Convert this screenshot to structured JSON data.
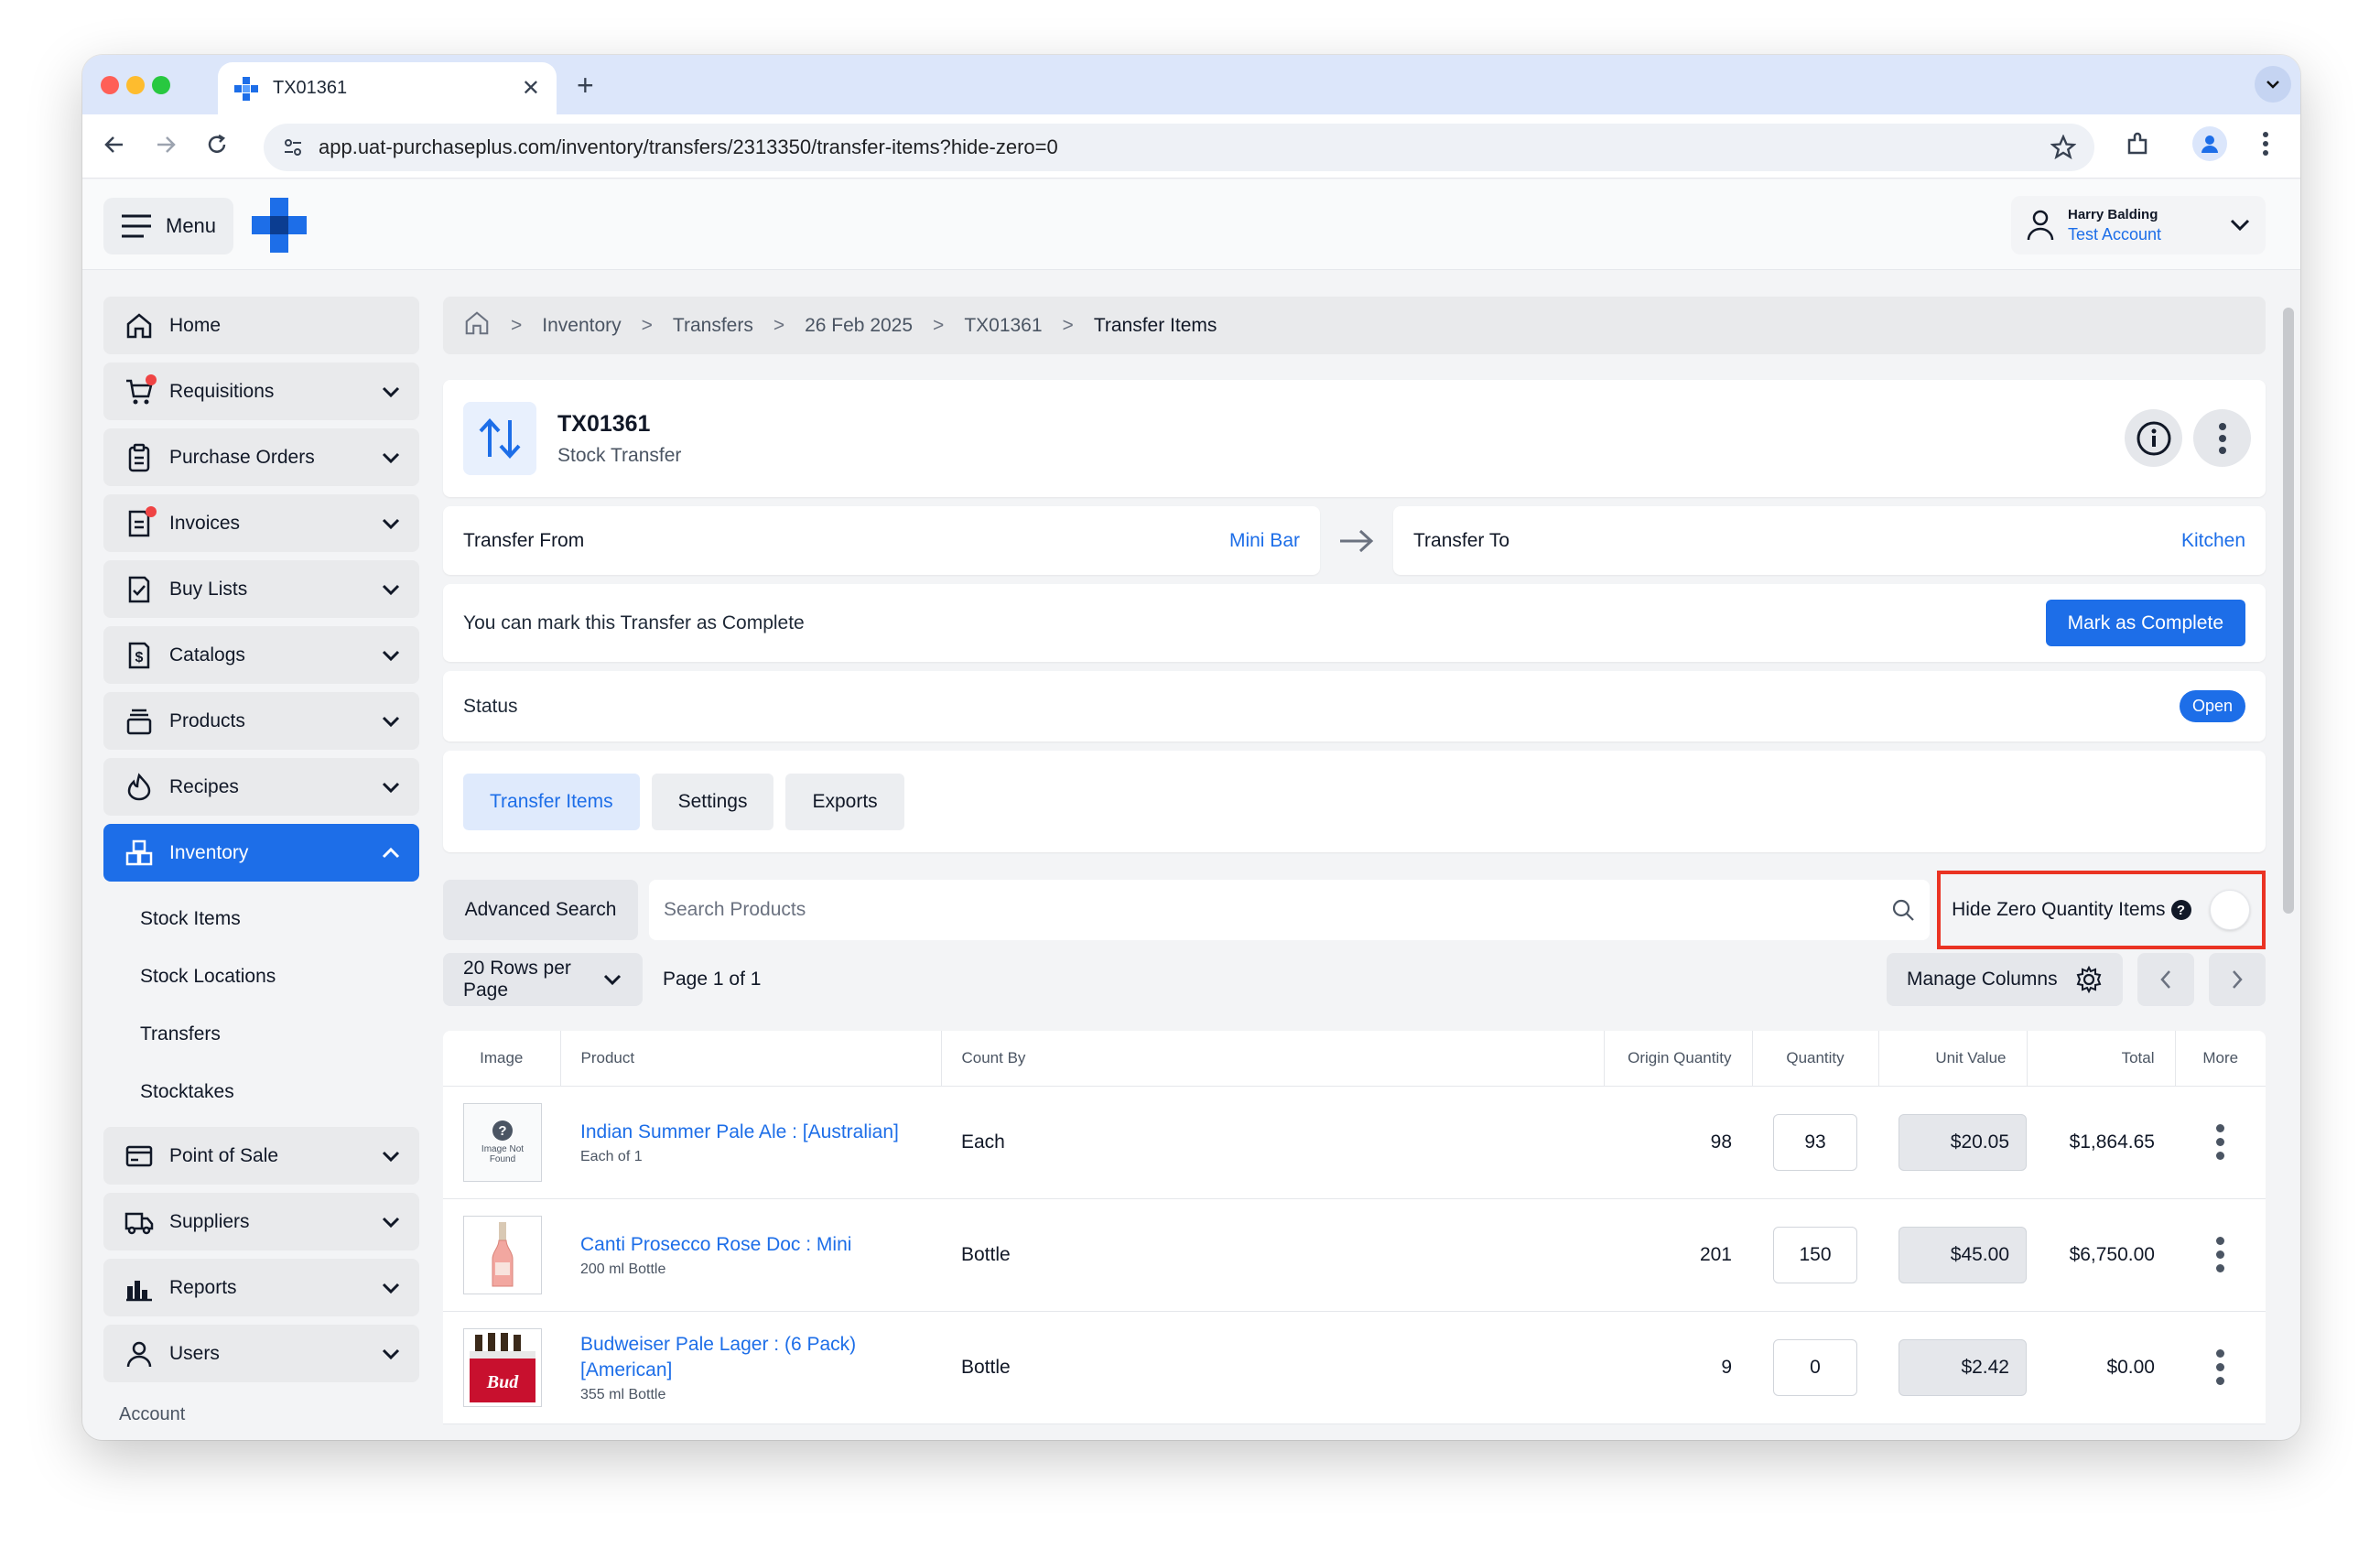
{
  "browser": {
    "tab_title": "TX01361",
    "url": "app.uat-purchaseplus.com/inventory/transfers/2313350/transfer-items?hide-zero=0"
  },
  "topbar": {
    "menu_label": "Menu",
    "user_name": "Harry Balding",
    "user_account": "Test Account"
  },
  "sidebar": {
    "items": [
      {
        "label": "Home",
        "icon": "home-icon"
      },
      {
        "label": "Requisitions",
        "icon": "cart-icon"
      },
      {
        "label": "Purchase Orders",
        "icon": "clipboard-icon"
      },
      {
        "label": "Invoices",
        "icon": "invoice-icon"
      },
      {
        "label": "Buy Lists",
        "icon": "checklist-icon"
      },
      {
        "label": "Catalogs",
        "icon": "catalog-icon"
      },
      {
        "label": "Products",
        "icon": "stack-icon"
      },
      {
        "label": "Recipes",
        "icon": "flame-icon"
      },
      {
        "label": "Inventory",
        "icon": "boxes-icon"
      }
    ],
    "inventory_sub": [
      "Stock Items",
      "Stock Locations",
      "Transfers",
      "Stocktakes"
    ],
    "items_after": [
      {
        "label": "Point of Sale",
        "icon": "card-icon"
      },
      {
        "label": "Suppliers",
        "icon": "truck-icon"
      },
      {
        "label": "Reports",
        "icon": "chart-icon"
      },
      {
        "label": "Users",
        "icon": "user-icon"
      }
    ],
    "account_label": "Account"
  },
  "breadcrumb": [
    "Inventory",
    "Transfers",
    "26 Feb 2025",
    "TX01361",
    "Transfer Items"
  ],
  "header": {
    "title": "TX01361",
    "subtitle": "Stock Transfer"
  },
  "transfer": {
    "from_label": "Transfer From",
    "from_value": "Mini Bar",
    "to_label": "Transfer To",
    "to_value": "Kitchen"
  },
  "complete": {
    "text": "You can mark this Transfer as Complete",
    "button": "Mark as Complete"
  },
  "status": {
    "label": "Status",
    "value": "Open"
  },
  "tabs": [
    "Transfer Items",
    "Settings",
    "Exports"
  ],
  "search": {
    "advanced_label": "Advanced Search",
    "placeholder": "Search Products",
    "hide_zero_label": "Hide Zero Quantity Items",
    "hide_zero_on": false
  },
  "pager": {
    "rows_label": "20 Rows per Page",
    "page_label": "Page 1 of 1",
    "manage_label": "Manage Columns"
  },
  "table": {
    "columns": [
      "Image",
      "Product",
      "Count By",
      "Origin Quantity",
      "Quantity",
      "Unit Value",
      "Total",
      "More"
    ],
    "rows": [
      {
        "image": "not-found",
        "image_text": "Image Not Found",
        "name": "Indian Summer Pale Ale : [Australian]",
        "sub": "Each of 1",
        "count_by": "Each",
        "origin": "98",
        "qty": "93",
        "unit": "$20.05",
        "total": "$1,864.65"
      },
      {
        "image": "bottle",
        "name": "Canti Prosecco Rose Doc : Mini",
        "sub": "200 ml Bottle",
        "count_by": "Bottle",
        "origin": "201",
        "qty": "150",
        "unit": "$45.00",
        "total": "$6,750.00"
      },
      {
        "image": "six-pack",
        "name": "Budweiser Pale Lager : (6 Pack) [American]",
        "sub": "355 ml Bottle",
        "count_by": "Bottle",
        "origin": "9",
        "qty": "0",
        "unit": "$2.42",
        "total": "$0.00"
      }
    ]
  },
  "colors": {
    "primary": "#1d6ee8",
    "highlight": "#ea3323",
    "notification": "#ef4444"
  }
}
